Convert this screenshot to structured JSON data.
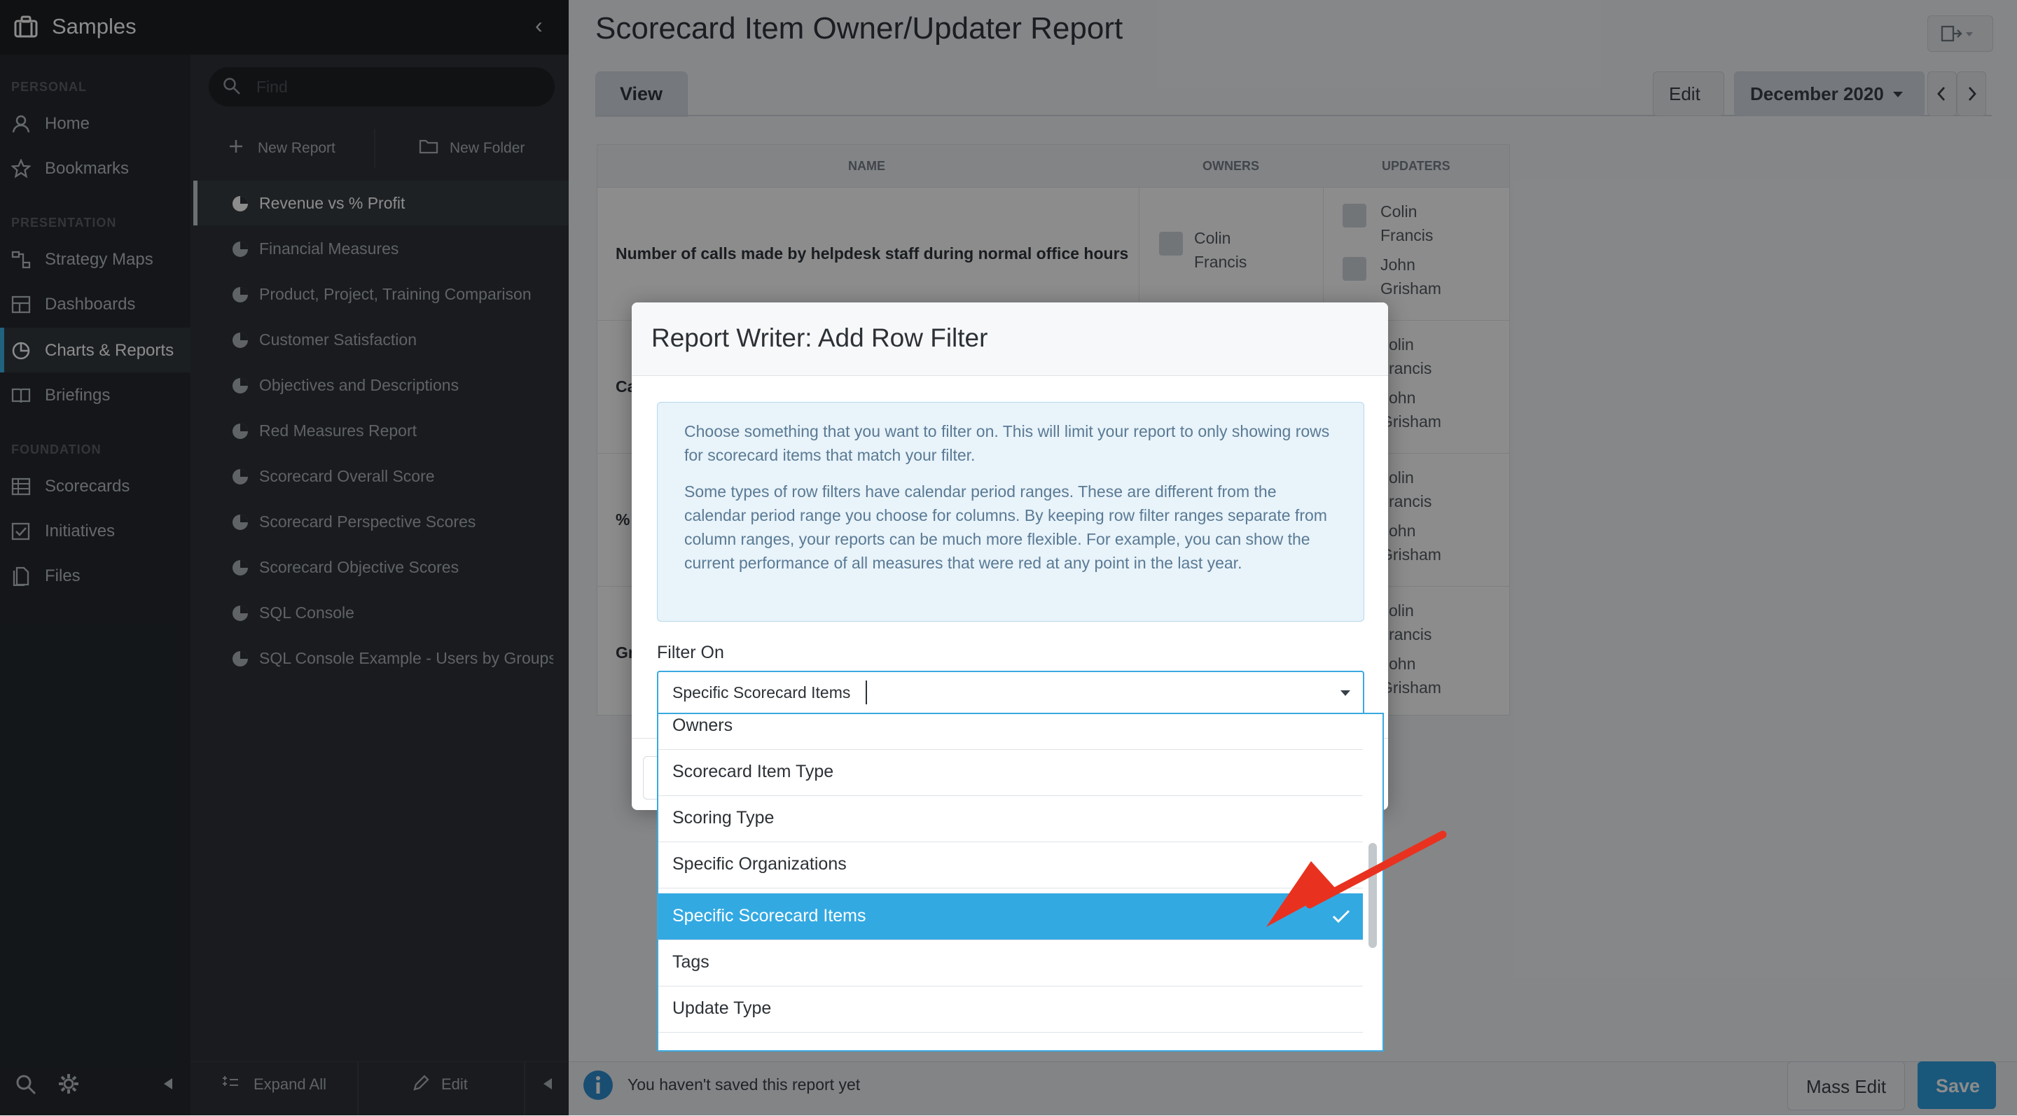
{
  "app": {
    "workspace_name": "Samples",
    "collapse_glyph": "‹"
  },
  "leftnav": {
    "sections": [
      {
        "title": "PERSONAL",
        "items": [
          {
            "label": "Home",
            "icon": "user-icon"
          },
          {
            "label": "Bookmarks",
            "icon": "star-icon"
          }
        ]
      },
      {
        "title": "PRESENTATION",
        "items": [
          {
            "label": "Strategy Maps",
            "icon": "strategy-map-icon"
          },
          {
            "label": "Dashboards",
            "icon": "dashboard-icon"
          },
          {
            "label": "Charts & Reports",
            "icon": "pie-chart-icon",
            "active": true
          },
          {
            "label": "Briefings",
            "icon": "book-icon"
          }
        ]
      },
      {
        "title": "FOUNDATION",
        "items": [
          {
            "label": "Scorecards",
            "icon": "grid-icon"
          },
          {
            "label": "Initiatives",
            "icon": "checkbox-icon"
          },
          {
            "label": "Files",
            "icon": "file-icon"
          }
        ]
      }
    ]
  },
  "reports_panel": {
    "search_placeholder": "Find",
    "new_report_label": "New Report",
    "new_folder_label": "New Folder",
    "items": [
      "Revenue vs % Profit",
      "Financial Measures",
      "Product, Project, Training Comparison",
      "Customer Satisfaction",
      "Objectives and Descriptions",
      "Red Measures Report",
      "Scorecard Overall Score",
      "Scorecard Perspective Scores",
      "Scorecard Objective Scores",
      "SQL Console",
      "SQL Console Example - Users by Groups"
    ],
    "active_index": 0,
    "expand_all_label": "Expand All",
    "edit_label": "Edit"
  },
  "main": {
    "title": "Scorecard Item Owner/Updater Report",
    "tab_view": "View",
    "edit_button": "Edit",
    "period_label": "December 2020",
    "table": {
      "headers": [
        "NAME",
        "OWNERS",
        "UPDATERS"
      ],
      "rows": [
        {
          "name": "Number of calls made by helpdesk staff during normal office hours",
          "owners": [
            "Colin",
            "Francis"
          ],
          "updaters": [
            [
              "Colin",
              "Francis"
            ],
            [
              "John",
              "Grisham"
            ]
          ]
        },
        {
          "name": "Ca",
          "updaters": [
            [
              "olin",
              "rancis"
            ],
            [
              "ohn",
              "Grisham"
            ]
          ]
        },
        {
          "name": "%",
          "updaters": [
            [
              "olin",
              "rancis"
            ],
            [
              "ohn",
              "Grisham"
            ]
          ]
        },
        {
          "name": "Gr",
          "updaters": [
            [
              "olin",
              "rancis"
            ],
            [
              "ohn",
              "Grisham"
            ]
          ]
        }
      ]
    },
    "footer_message": "You haven't saved this report yet",
    "mass_edit_button": "Mass Edit",
    "save_button": "Save"
  },
  "modal": {
    "title": "Report Writer: Add Row Filter",
    "info_para1": "Choose something that you want to filter on. This will limit your report to only showing rows for scorecard items that match your filter.",
    "info_para2": "Some types of row filters have calendar period ranges. These are different from the calendar period range you choose for columns. By keeping row filter ranges separate from column ranges, your reports can be much more flexible. For example, you can show the current performance of all measures that were red at any point in the last year.",
    "filter_on_label": "Filter On",
    "selected_value": "Specific Scorecard Items",
    "options": [
      "Owners",
      "Scorecard Item Type",
      "Scoring Type",
      "Specific Organizations",
      "Specific Scorecard Items",
      "Tags",
      "Update Type"
    ],
    "selected_index": 4
  },
  "colors": {
    "accent": "#33a9e2",
    "arrow": "#e8321f",
    "nav_bg": "#25292e"
  }
}
